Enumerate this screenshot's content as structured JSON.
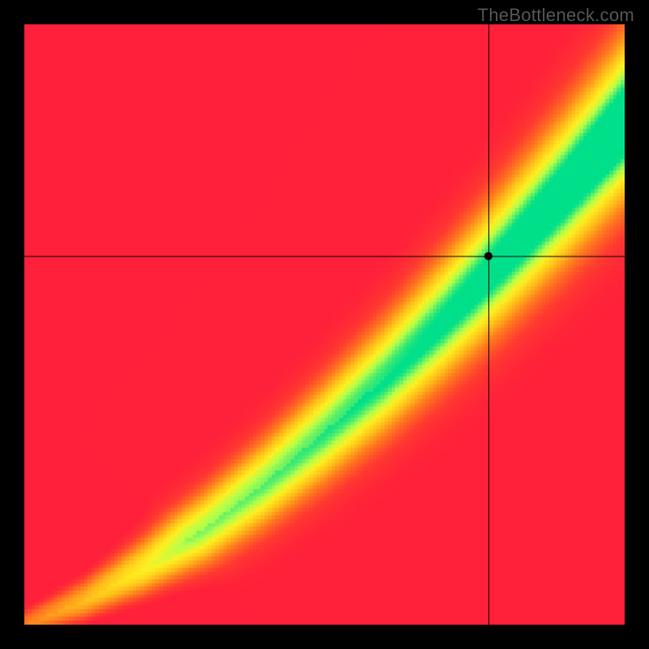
{
  "attribution": "TheBottleneck.com",
  "chart_data": {
    "type": "heatmap",
    "title": "",
    "xlabel": "",
    "ylabel": "",
    "xlim": [
      0,
      1
    ],
    "ylim": [
      0,
      1
    ],
    "note": "Bottleneck heatmap. x = CPU score (normalized), y = GPU score (normalized). Color encodes fit quality: red = poor match, yellow = moderate, green = balanced. Crosshair marks the evaluated CPU/GPU pair.",
    "colormap_stops": [
      {
        "t": 0.0,
        "color": "#ff203b"
      },
      {
        "t": 0.15,
        "color": "#ff3a30"
      },
      {
        "t": 0.35,
        "color": "#ff7a1f"
      },
      {
        "t": 0.55,
        "color": "#ffc21a"
      },
      {
        "t": 0.72,
        "color": "#fff021"
      },
      {
        "t": 0.85,
        "color": "#b6ff4a"
      },
      {
        "t": 1.0,
        "color": "#00e08a"
      }
    ],
    "crosshair": {
      "x": 0.773,
      "y": 0.614
    },
    "marker": {
      "x": 0.773,
      "y": 0.614,
      "radius": 5
    },
    "ridge": {
      "description": "Green optimal band follows roughly y ≈ 0.68 * x^1.25, widening toward top-right.",
      "approx_points": [
        {
          "x": 0.0,
          "y": 0.0
        },
        {
          "x": 0.1,
          "y": 0.04
        },
        {
          "x": 0.2,
          "y": 0.095
        },
        {
          "x": 0.3,
          "y": 0.16
        },
        {
          "x": 0.4,
          "y": 0.235
        },
        {
          "x": 0.5,
          "y": 0.32
        },
        {
          "x": 0.6,
          "y": 0.41
        },
        {
          "x": 0.7,
          "y": 0.51
        },
        {
          "x": 0.8,
          "y": 0.615
        },
        {
          "x": 0.9,
          "y": 0.725
        },
        {
          "x": 1.0,
          "y": 0.84
        }
      ],
      "band_halfwidth_start": 0.01,
      "band_halfwidth_end": 0.09
    }
  }
}
